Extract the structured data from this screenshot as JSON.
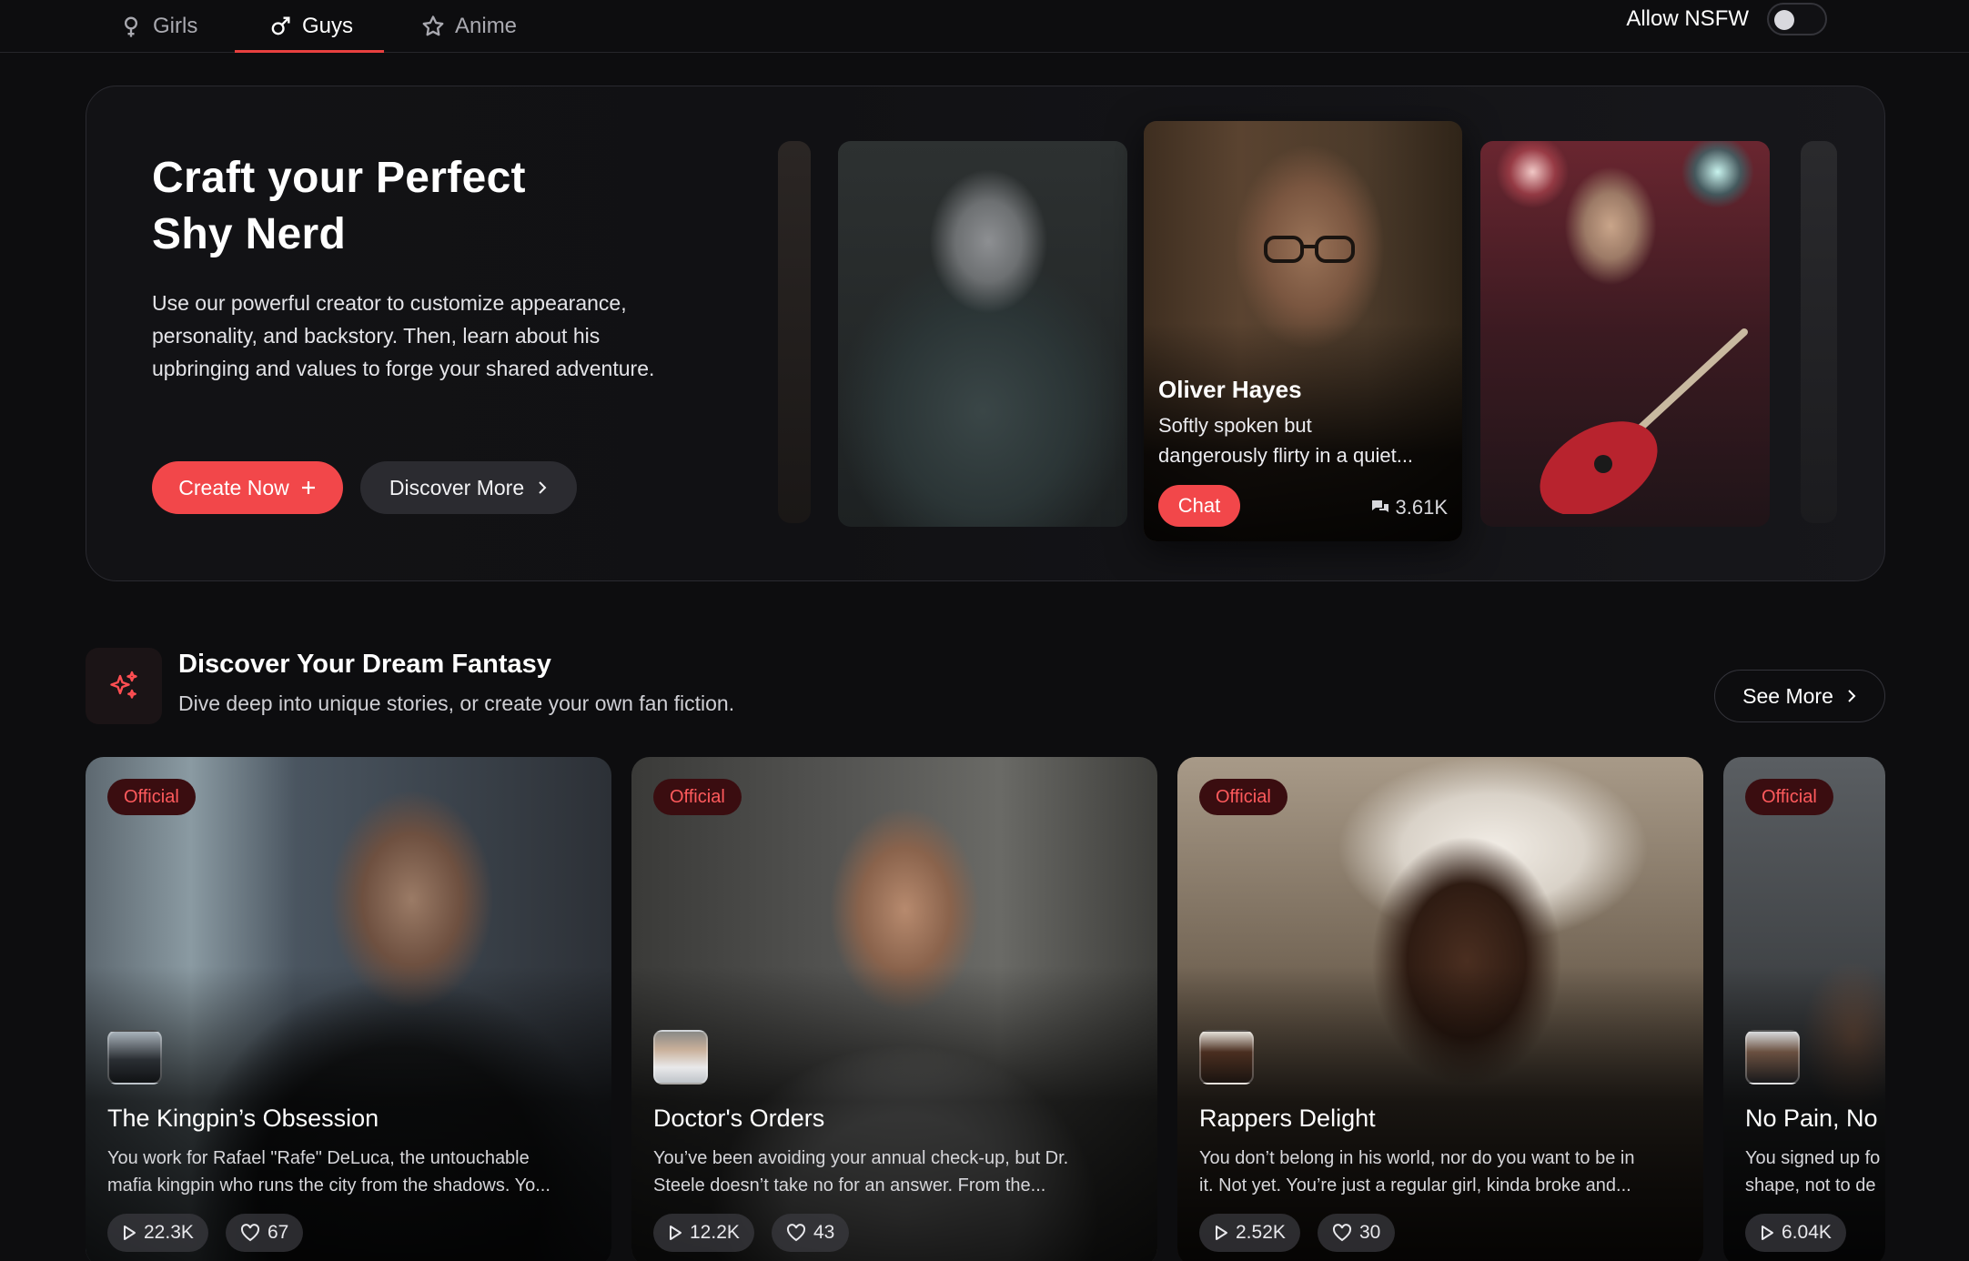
{
  "nav": {
    "tabs": [
      {
        "label": "Girls",
        "icon": "female-icon"
      },
      {
        "label": "Guys",
        "icon": "male-icon",
        "active": true
      },
      {
        "label": "Anime",
        "icon": "star-icon"
      }
    ],
    "nsfw_label": "Allow NSFW",
    "nsfw_enabled": false
  },
  "hero": {
    "title_line1": "Craft your Perfect",
    "title_line2": "Shy Nerd",
    "description": "Use our powerful creator to customize appearance, personality, and backstory. Then, learn about his upbringing and values to forge your shared adventure.",
    "create_label": "Create Now",
    "discover_label": "Discover More",
    "featured": {
      "name": "Oliver Hayes",
      "description_line1": "Softly spoken but",
      "description_line2": "dangerously flirty in a quiet...",
      "chat_label": "Chat",
      "chat_count": "3.61K"
    }
  },
  "discover": {
    "title": "Discover Your Dream Fantasy",
    "subtitle": "Dive deep into unique stories, or create your own fan fiction.",
    "see_more_label": "See More",
    "stories": [
      {
        "badge": "Official",
        "title": "The Kingpin’s Obsession",
        "desc_line1": "You work for Rafael \"Rafe\" DeLuca, the untouchable",
        "desc_line2": "mafia kingpin who runs the city from the shadows. Yo...",
        "plays": "22.3K",
        "likes": "67"
      },
      {
        "badge": "Official",
        "title": "Doctor's Orders",
        "desc_line1": "You’ve been avoiding your annual check-up, but Dr.",
        "desc_line2": "Steele doesn’t take no for an answer. From the...",
        "plays": "12.2K",
        "likes": "43"
      },
      {
        "badge": "Official",
        "title": "Rappers Delight",
        "desc_line1": "You don’t belong in his world, nor do you want to be in",
        "desc_line2": "it. Not yet. You’re just a regular girl, kinda broke and...",
        "plays": "2.52K",
        "likes": "30"
      },
      {
        "badge": "Official",
        "title": "No Pain, No",
        "desc_line1": "You signed up fo",
        "desc_line2": "shape, not to de",
        "plays": "6.04K",
        "likes": ""
      }
    ]
  },
  "colors": {
    "accent": "#f2474a",
    "badge_bg": "#3a0d10",
    "badge_text": "#ff5a5c",
    "background": "#0d0d0f"
  }
}
